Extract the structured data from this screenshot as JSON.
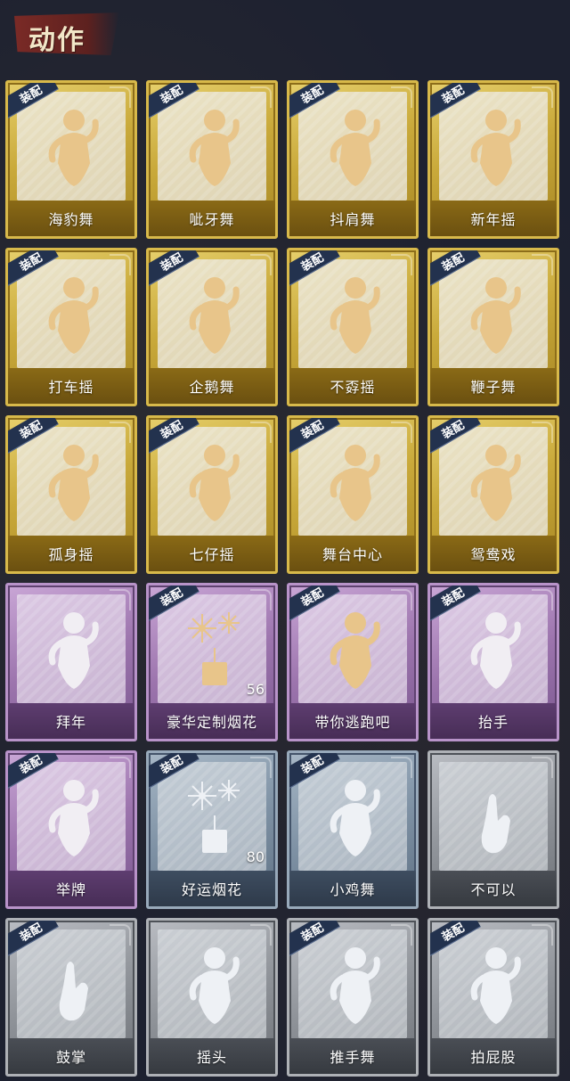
{
  "header": {
    "title": "动作"
  },
  "equip_label": "装配",
  "cards": [
    {
      "label": "海豹舞",
      "tier": "gold",
      "equipped": true,
      "icon": "seal-dance-figure-icon"
    },
    {
      "label": "呲牙舞",
      "tier": "gold",
      "equipped": true,
      "icon": "grin-dance-figure-icon"
    },
    {
      "label": "抖肩舞",
      "tier": "gold",
      "equipped": true,
      "icon": "shoulder-shake-figure-icon"
    },
    {
      "label": "新年摇",
      "tier": "gold",
      "equipped": true,
      "icon": "new-year-sway-figure-icon"
    },
    {
      "label": "打车摇",
      "tier": "gold",
      "equipped": true,
      "icon": "taxi-sway-figure-icon"
    },
    {
      "label": "企鹅舞",
      "tier": "gold",
      "equipped": true,
      "icon": "penguin-dance-figure-icon"
    },
    {
      "label": "不孬摇",
      "tier": "gold",
      "equipped": true,
      "icon": "not-bad-sway-figure-icon"
    },
    {
      "label": "鞭子舞",
      "tier": "gold",
      "equipped": true,
      "icon": "whip-dance-figure-icon"
    },
    {
      "label": "孤身摇",
      "tier": "gold",
      "equipped": true,
      "icon": "solo-sway-figure-icon"
    },
    {
      "label": "七仔摇",
      "tier": "gold",
      "equipped": true,
      "icon": "qizai-sway-figure-icon"
    },
    {
      "label": "舞台中心",
      "tier": "gold",
      "equipped": true,
      "icon": "center-stage-figure-icon"
    },
    {
      "label": "鸳鸯戏",
      "tier": "gold",
      "equipped": true,
      "icon": "mandarin-duck-figure-icon"
    },
    {
      "label": "拜年",
      "tier": "purple",
      "equipped": false,
      "icon": "new-year-greeting-figure-icon"
    },
    {
      "label": "豪华定制烟花",
      "tier": "purple",
      "equipped": true,
      "icon": "deluxe-fireworks-icon",
      "count": "56"
    },
    {
      "label": "带你逃跑吧",
      "tier": "purple",
      "equipped": true,
      "icon": "run-away-figure-icon"
    },
    {
      "label": "抬手",
      "tier": "purple",
      "equipped": true,
      "icon": "raise-hand-figure-icon"
    },
    {
      "label": "举牌",
      "tier": "purple",
      "equipped": true,
      "icon": "hold-sign-figure-icon"
    },
    {
      "label": "好运烟花",
      "tier": "blue",
      "equipped": true,
      "icon": "lucky-fireworks-icon",
      "count": "80"
    },
    {
      "label": "小鸡舞",
      "tier": "blue",
      "equipped": true,
      "icon": "chicken-dance-figure-icon"
    },
    {
      "label": "不可以",
      "tier": "grey",
      "equipped": false,
      "icon": "no-finger-wag-icon"
    },
    {
      "label": "鼓掌",
      "tier": "grey",
      "equipped": true,
      "icon": "clap-hands-icon"
    },
    {
      "label": "摇头",
      "tier": "grey",
      "equipped": false,
      "icon": "shake-head-figure-icon"
    },
    {
      "label": "推手舞",
      "tier": "grey",
      "equipped": true,
      "icon": "push-hand-dance-figure-icon"
    },
    {
      "label": "拍屁股",
      "tier": "grey",
      "equipped": true,
      "icon": "pat-butt-figure-icon"
    }
  ]
}
